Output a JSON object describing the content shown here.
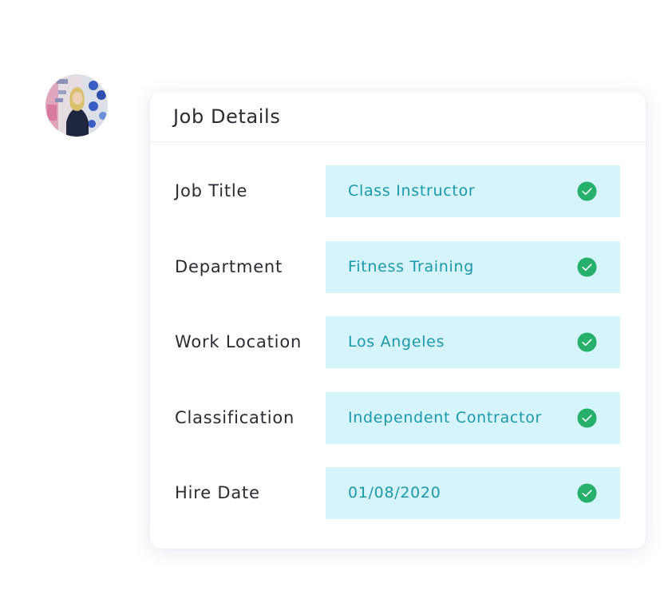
{
  "card": {
    "title": "Job Details"
  },
  "fields": [
    {
      "label": "Job Title",
      "value": "Class Instructor",
      "status_icon": "check-icon"
    },
    {
      "label": "Department",
      "value": "Fitness Training",
      "status_icon": "check-icon"
    },
    {
      "label": "Work Location",
      "value": "Los Angeles",
      "status_icon": "check-icon"
    },
    {
      "label": "Classification",
      "value": "Independent Contractor",
      "status_icon": "check-icon"
    },
    {
      "label": "Hire Date",
      "value": "01/08/2020",
      "status_icon": "check-icon"
    }
  ],
  "colors": {
    "field_background": "#d5f4fc",
    "field_text": "#1a99a8",
    "check_green": "#27b06b",
    "label_text": "#2a2b33"
  }
}
